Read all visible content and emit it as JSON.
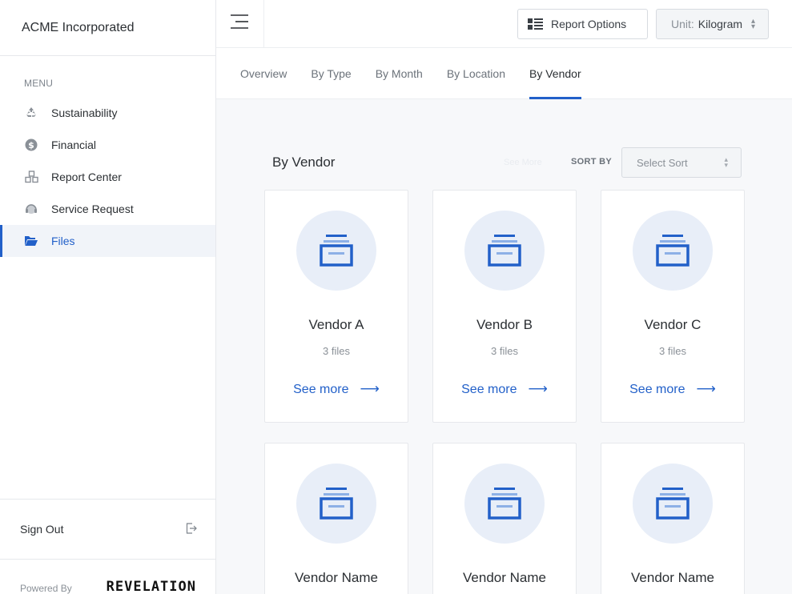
{
  "brand": {
    "name": "ACME Incorporated"
  },
  "sidebar": {
    "menu_label": "MENU",
    "items": [
      {
        "label": "Sustainability",
        "icon": "recycle-icon"
      },
      {
        "label": "Financial",
        "icon": "dollar-icon"
      },
      {
        "label": "Report Center",
        "icon": "cubes-icon"
      },
      {
        "label": "Service Request",
        "icon": "headset-icon"
      },
      {
        "label": "Files",
        "icon": "folder-open-icon",
        "active": true
      }
    ],
    "sign_out": "Sign Out",
    "powered_by": "Powered By",
    "powered_logo": "REVELATION"
  },
  "topbar": {
    "report_options": "Report Options",
    "unit_label": "Unit:",
    "unit_value": "Kilogram"
  },
  "tabs": [
    {
      "label": "Overview"
    },
    {
      "label": "By Type"
    },
    {
      "label": "By Month"
    },
    {
      "label": "By Location"
    },
    {
      "label": "By Vendor",
      "active": true
    }
  ],
  "section": {
    "title": "By Vendor",
    "hidden_link": "See More",
    "sort_by_label": "SORT BY",
    "sort_placeholder": "Select Sort"
  },
  "vendors": [
    {
      "name": "Vendor A",
      "count": "3 files",
      "link": "See more"
    },
    {
      "name": "Vendor B",
      "count": "3 files",
      "link": "See more"
    },
    {
      "name": "Vendor C",
      "count": "3 files",
      "link": "See more"
    },
    {
      "name": "Vendor Name",
      "count": "",
      "link": ""
    },
    {
      "name": "Vendor Name",
      "count": "",
      "link": ""
    },
    {
      "name": "Vendor Name",
      "count": "",
      "link": ""
    }
  ],
  "colors": {
    "accent": "#2260c9",
    "icon_circle": "#e8eef8",
    "archive_light": "#8db0e6"
  }
}
